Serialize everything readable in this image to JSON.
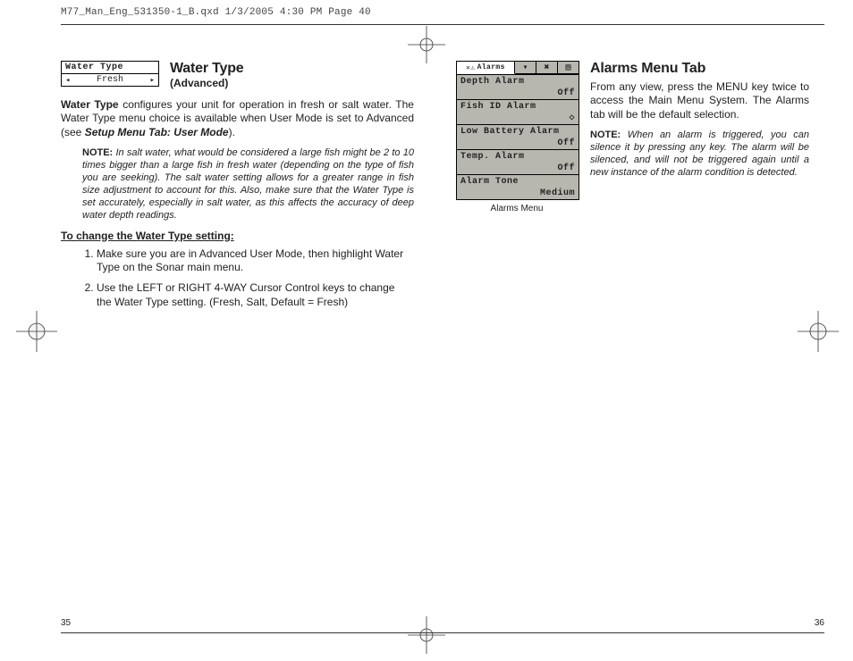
{
  "header": "M77_Man_Eng_531350-1_B.qxd  1/3/2005  4:30 PM  Page 40",
  "page_numbers": {
    "left": "35",
    "right": "36"
  },
  "left_page": {
    "widget": {
      "title": "Water Type",
      "value": "Fresh"
    },
    "title": "Water Type",
    "subtitle": "(Advanced)",
    "intro_bold": "Water Type",
    "intro_rest": " configures your unit for operation in fresh or salt water. The Water Type menu choice is available when User Mode is set to Advanced (see ",
    "intro_ref": "Setup Menu Tab: User Mode",
    "intro_tail": ").",
    "note_label": "NOTE:",
    "note_text": "  In salt water, what would be considered a large fish might be 2 to 10 times bigger than a large fish in fresh water (depending on the type of fish you are seeking).  The salt water setting allows for a greater range in fish size adjustment to account for this. Also, make sure that the Water Type is set accurately, especially in salt water, as this affects the accuracy of deep water depth readings.",
    "procedure_title": "To change the Water Type setting:",
    "steps": [
      "Make sure you are in Advanced User Mode, then highlight Water Type on the Sonar main menu.",
      "Use the LEFT or RIGHT 4-WAY Cursor Control keys to change the Water Type setting. (Fresh, Salt, Default = Fresh)"
    ]
  },
  "right_page": {
    "title": "Alarms Menu Tab",
    "intro": "From any view, press the MENU key twice to access the Main Menu System. The Alarms tab will be the default selection.",
    "note_label": "NOTE:",
    "note_text": " When an alarm is triggered, you can silence it by pressing any key. The alarm will be silenced, and will not be triggered again until a new instance of the alarm condition is detected.",
    "widget": {
      "tab_label": "Alarms",
      "caption": "Alarms Menu",
      "rows": [
        {
          "name": "Depth Alarm",
          "value": "Off"
        },
        {
          "name": "Fish ID Alarm",
          "value": "◇"
        },
        {
          "name": "Low Battery Alarm",
          "value": "Off"
        },
        {
          "name": "Temp. Alarm",
          "value": "Off"
        },
        {
          "name": "Alarm Tone",
          "value": "Medium"
        }
      ]
    }
  }
}
